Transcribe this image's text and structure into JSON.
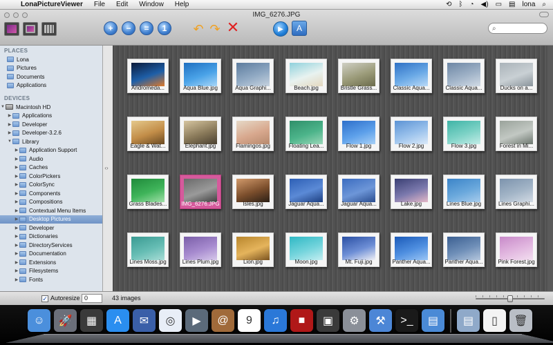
{
  "menubar": {
    "app_name": "LonaPictureViewer",
    "items": [
      "File",
      "Edit",
      "Window",
      "Help"
    ],
    "user": "lona"
  },
  "window": {
    "title": "IMG_6276.JPG",
    "search_placeholder": ""
  },
  "sidebar": {
    "places_header": "PLACES",
    "places": [
      "Lona",
      "Pictures",
      "Documents",
      "Applications"
    ],
    "devices_header": "DEVICES",
    "device_root": "Macintosh HD",
    "tree": [
      {
        "label": "Applications",
        "level": 1,
        "expanded": false
      },
      {
        "label": "Developer",
        "level": 1,
        "expanded": false
      },
      {
        "label": "Developer-3.2.6",
        "level": 1,
        "expanded": false
      },
      {
        "label": "Library",
        "level": 1,
        "expanded": true
      },
      {
        "label": "Application Support",
        "level": 2,
        "expanded": false
      },
      {
        "label": "Audio",
        "level": 2,
        "expanded": false
      },
      {
        "label": "Caches",
        "level": 2,
        "expanded": false
      },
      {
        "label": "ColorPickers",
        "level": 2,
        "expanded": false
      },
      {
        "label": "ColorSync",
        "level": 2,
        "expanded": false
      },
      {
        "label": "Components",
        "level": 2,
        "expanded": false
      },
      {
        "label": "Compositions",
        "level": 2,
        "expanded": false
      },
      {
        "label": "Contextual Menu Items",
        "level": 2,
        "expanded": false
      },
      {
        "label": "Desktop Pictures",
        "level": 2,
        "expanded": false,
        "selected": true
      },
      {
        "label": "Developer",
        "level": 2,
        "expanded": false
      },
      {
        "label": "Dictionaries",
        "level": 2,
        "expanded": false
      },
      {
        "label": "DirectoryServices",
        "level": 2,
        "expanded": false
      },
      {
        "label": "Documentation",
        "level": 2,
        "expanded": false
      },
      {
        "label": "Extensions",
        "level": 2,
        "expanded": false
      },
      {
        "label": "Filesystems",
        "level": 2,
        "expanded": false
      },
      {
        "label": "Fonts",
        "level": 2,
        "expanded": false
      }
    ]
  },
  "images": [
    {
      "name": "Andromeda...",
      "c": [
        "#0b1a3a",
        "#1e5fa8",
        "#e07a2a"
      ]
    },
    {
      "name": "Aqua Blue.jpg",
      "c": [
        "#1f6fc0",
        "#4aa3e8",
        "#a8d6f7"
      ]
    },
    {
      "name": "Aqua Graphi...",
      "c": [
        "#5d7c9e",
        "#90a9c3",
        "#c7d3df"
      ]
    },
    {
      "name": "Beach.jpg",
      "c": [
        "#8fd1dc",
        "#e8f2f0",
        "#e4d8bf"
      ]
    },
    {
      "name": "Bristle Grass...",
      "c": [
        "#cfcfc4",
        "#9a9a78",
        "#6b6b4b"
      ]
    },
    {
      "name": "Classic Aqua...",
      "c": [
        "#2f71c5",
        "#6aa9e6",
        "#b9d9f6"
      ]
    },
    {
      "name": "Classic Aqua...",
      "c": [
        "#6d86a4",
        "#9fb2c7",
        "#d2dbe5"
      ]
    },
    {
      "name": "Ducks on a...",
      "c": [
        "#aab3b9",
        "#c9d0d4",
        "#8a949b"
      ]
    },
    {
      "name": "Eagle & Wat...",
      "c": [
        "#e5c98c",
        "#c28d48",
        "#6a4a22"
      ]
    },
    {
      "name": "Elephant.jpg",
      "c": [
        "#d6c5a0",
        "#8a7a5a",
        "#4a4030"
      ]
    },
    {
      "name": "Flamingos.jpg",
      "c": [
        "#e6d9c7",
        "#d8a88e",
        "#b78a6e"
      ]
    },
    {
      "name": "Floating Lea...",
      "c": [
        "#2f8f6a",
        "#4cb48a",
        "#9ad6b8"
      ]
    },
    {
      "name": "Flow 1.jpg",
      "c": [
        "#2e6fca",
        "#5da0ea",
        "#a7d0f6"
      ]
    },
    {
      "name": "Flow 2.jpg",
      "c": [
        "#5c93d4",
        "#9bc2ec",
        "#dbe9f8"
      ]
    },
    {
      "name": "Flow 3.jpg",
      "c": [
        "#3fb4a6",
        "#7dd2c6",
        "#c3ece7"
      ]
    },
    {
      "name": "Forest in Mi...",
      "c": [
        "#9aa39b",
        "#c2c8c3",
        "#6d776f"
      ]
    },
    {
      "name": "Grass Blades...",
      "c": [
        "#1f8a3a",
        "#3fb45a",
        "#a0e0a8"
      ]
    },
    {
      "name": "IMG_6276.JPG",
      "c": [
        "#6a6a6a",
        "#9a9a9a",
        "#3f3f3f"
      ],
      "selected": true
    },
    {
      "name": "Isles.jpg",
      "c": [
        "#d29a6b",
        "#7b4e2c",
        "#2b1f16"
      ]
    },
    {
      "name": "Jaguar Aqua...",
      "c": [
        "#2d5fb5",
        "#5b8ad6",
        "#1d3f80"
      ]
    },
    {
      "name": "Jaguar Aqua...",
      "c": [
        "#3b6cc0",
        "#6d96d8",
        "#2a4d8f"
      ]
    },
    {
      "name": "Lake.jpg",
      "c": [
        "#3a3f73",
        "#7b79ad",
        "#e4b8c7"
      ]
    },
    {
      "name": "Lines Blue.jpg",
      "c": [
        "#3b84c8",
        "#6aa8dc",
        "#a8ccec"
      ]
    },
    {
      "name": "Lines Graphi...",
      "c": [
        "#7c93ad",
        "#a3b5c7",
        "#d3dbe4"
      ]
    },
    {
      "name": "Lines Moss.jpg",
      "c": [
        "#3a9a92",
        "#66bdb4",
        "#a9ddd6"
      ]
    },
    {
      "name": "Lines Plum.jpg",
      "c": [
        "#7a5ea8",
        "#a78bcf",
        "#d7c9ea"
      ]
    },
    {
      "name": "Lion.jpg",
      "c": [
        "#b8862d",
        "#e5b45c",
        "#7a5320"
      ]
    },
    {
      "name": "Moon.jpg",
      "c": [
        "#2fb8c4",
        "#74d4dc",
        "#c4eef1"
      ]
    },
    {
      "name": "Mt. Fuji.jpg",
      "c": [
        "#2a4fa3",
        "#6e8fd6",
        "#f0f0f5"
      ]
    },
    {
      "name": "Panther Aqua...",
      "c": [
        "#1b5ab8",
        "#4f8fe0",
        "#9bc6f5"
      ]
    },
    {
      "name": "Panther Aqua...",
      "c": [
        "#3b5f91",
        "#6f8fb8",
        "#b5c7dd"
      ]
    },
    {
      "name": "Pink Forest.jpg",
      "c": [
        "#c88ac9",
        "#e2b8e0",
        "#f3dff0"
      ]
    }
  ],
  "statusbar": {
    "autoresize_label": "Autoresize",
    "autoresize_checked": true,
    "autoresize_value": "0",
    "image_count": "43 images"
  },
  "dock": [
    {
      "name": "finder",
      "color": "#4b8fdc",
      "glyph": "☺"
    },
    {
      "name": "launchpad",
      "color": "#6b6f7a",
      "glyph": "🚀"
    },
    {
      "name": "mission-control",
      "color": "#3a3a3a",
      "glyph": "▦"
    },
    {
      "name": "app-store",
      "color": "#2a8ef0",
      "glyph": "A"
    },
    {
      "name": "mail-stamp",
      "color": "#3a5fa8",
      "glyph": "✉"
    },
    {
      "name": "safari",
      "color": "#e8eef7",
      "glyph": "◎"
    },
    {
      "name": "facetime",
      "color": "#5b6a7a",
      "glyph": "▶"
    },
    {
      "name": "address-book",
      "color": "#a06a3a",
      "glyph": "@"
    },
    {
      "name": "ical",
      "color": "#ffffff",
      "glyph": "9"
    },
    {
      "name": "itunes",
      "color": "#2a78d8",
      "glyph": "♫"
    },
    {
      "name": "photo-booth",
      "color": "#b01818",
      "glyph": "■"
    },
    {
      "name": "image-app",
      "color": "#3a3a3a",
      "glyph": "▣"
    },
    {
      "name": "system-preferences",
      "color": "#8a8f98",
      "glyph": "⚙"
    },
    {
      "name": "xcode",
      "color": "#4c86d6",
      "glyph": "⚒"
    },
    {
      "name": "terminal",
      "color": "#1a1a1a",
      "glyph": ">_"
    },
    {
      "name": "preview",
      "color": "#4a8ad6",
      "glyph": "▤"
    },
    {
      "name": "applications-folder",
      "color": "#8fa9c9",
      "glyph": "▤"
    },
    {
      "name": "document",
      "color": "#f3f3f3",
      "glyph": "▯"
    },
    {
      "name": "trash",
      "color": "#b9bec6",
      "glyph": "🗑"
    }
  ]
}
